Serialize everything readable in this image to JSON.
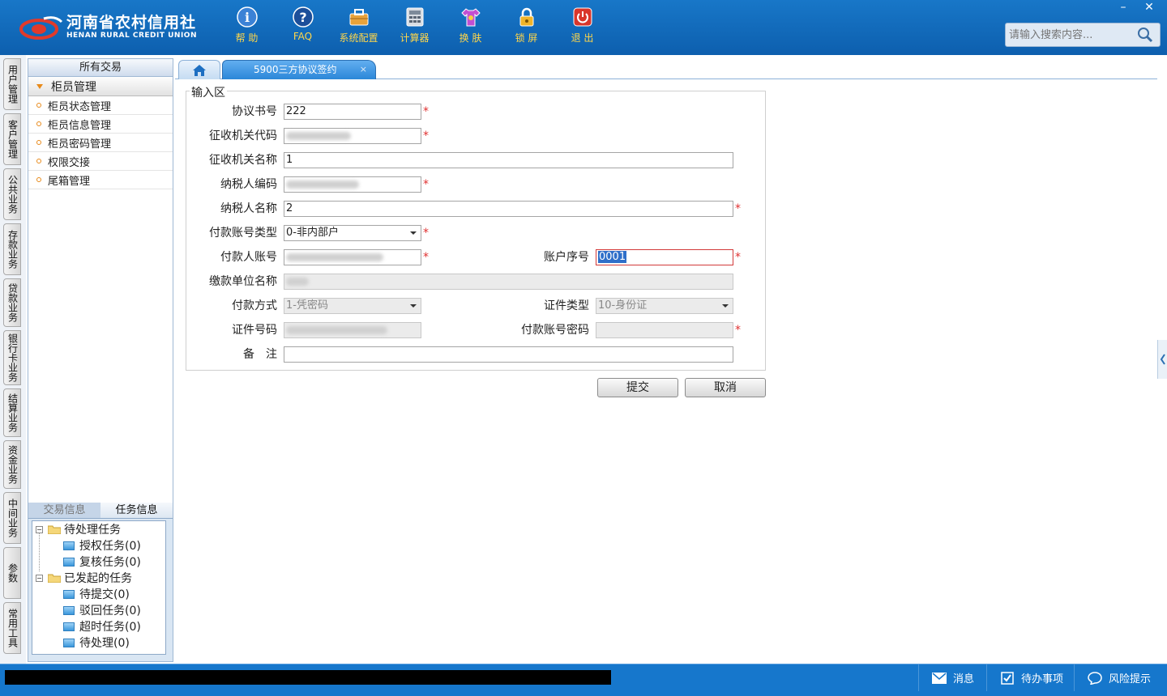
{
  "header": {
    "logo_cn": "河南省农村信用社",
    "logo_en": "HENAN RURAL CREDIT UNION",
    "toolbar": [
      {
        "label": "帮 助",
        "icon": "info-icon"
      },
      {
        "label": "FAQ",
        "icon": "help-icon"
      },
      {
        "label": "系统配置",
        "icon": "toolbox-icon"
      },
      {
        "label": "计算器",
        "icon": "calculator-icon"
      },
      {
        "label": "换 肤",
        "icon": "shirt-icon"
      },
      {
        "label": "锁 屏",
        "icon": "lock-icon"
      },
      {
        "label": "退 出",
        "icon": "power-icon"
      }
    ],
    "search_placeholder": "请输入搜索内容...",
    "win_min": "–",
    "win_close": "✕"
  },
  "vtabs": [
    "用户管理",
    "客户管理",
    "公共业务",
    "存款业务",
    "贷款业务",
    "银行卡业务",
    "结算业务",
    "资金业务",
    "中间业务",
    "参数",
    "常用工具"
  ],
  "sidebar": {
    "title": "所有交易",
    "group": "柜员管理",
    "items": [
      "柜员状态管理",
      "柜员信息管理",
      "柜员密码管理",
      "权限交接",
      "尾箱管理"
    ]
  },
  "tasks": {
    "tab_info": "交易信息",
    "tab_task": "任务信息",
    "pending_root": "待处理任务",
    "pending": [
      "授权任务(0)",
      "复核任务(0)"
    ],
    "started_root": "已发起的任务",
    "started": [
      "待提交(0)",
      "驳回任务(0)",
      "超时任务(0)",
      "待处理(0)"
    ]
  },
  "tabs": {
    "active": "5900三方协议签约",
    "close": "×"
  },
  "form": {
    "legend": "输入区",
    "agreement_no_label": "协议书号",
    "agreement_no": "222",
    "tax_office_code_label": "征收机关代码",
    "tax_office_name_label": "征收机关名称",
    "tax_office_name": "1",
    "taxpayer_code_label": "纳税人编码",
    "taxpayer_name_label": "纳税人名称",
    "taxpayer_name": "2",
    "account_type_label": "付款账号类型",
    "account_type": "0-非内部户",
    "payer_account_label": "付款人账号",
    "account_seq_label": "账户序号",
    "account_seq": "0001",
    "payer_unit_label": "缴款单位名称",
    "pay_method_label": "付款方式",
    "pay_method": "1-凭密码",
    "id_type_label": "证件类型",
    "id_type": "10-身份证",
    "id_no_label": "证件号码",
    "account_pwd_label": "付款账号密码",
    "remark_label": "备　注",
    "required_mark": "*",
    "submit": "提交",
    "cancel": "取消"
  },
  "statusbar": {
    "message": "消息",
    "todo": "待办事项",
    "risk": "风险提示"
  }
}
